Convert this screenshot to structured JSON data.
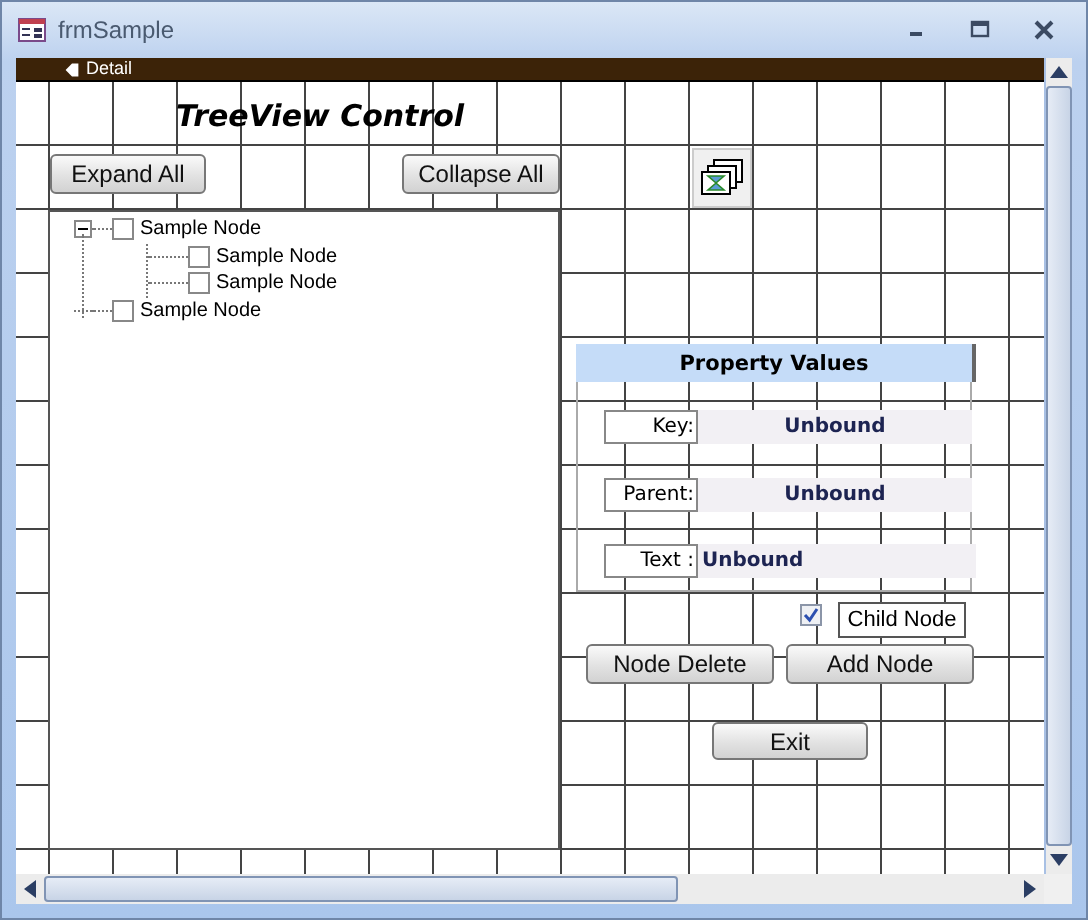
{
  "window": {
    "title": "frmSample"
  },
  "section": {
    "label": "Detail"
  },
  "heading": "TreeView Control",
  "tree_buttons": [
    "Expand All",
    "Collapse All"
  ],
  "tree": [
    {
      "label": "Sample Node",
      "checked": false,
      "expanded": true,
      "children": [
        {
          "label": "Sample Node",
          "checked": false
        },
        {
          "label": "Sample Node",
          "checked": false
        }
      ]
    },
    {
      "label": "Sample Node",
      "checked": false
    }
  ],
  "property_values": {
    "title": "Property Values",
    "fields": [
      {
        "label": "Key:",
        "value": "Unbound"
      },
      {
        "label": "Parent:",
        "value": "Unbound"
      },
      {
        "label": "Text :",
        "value": "Unbound"
      }
    ]
  },
  "child_node": {
    "checked": true,
    "label": "Child Node"
  },
  "node_buttons": [
    "Node Delete",
    "Add Node"
  ],
  "exit_button": "Exit"
}
